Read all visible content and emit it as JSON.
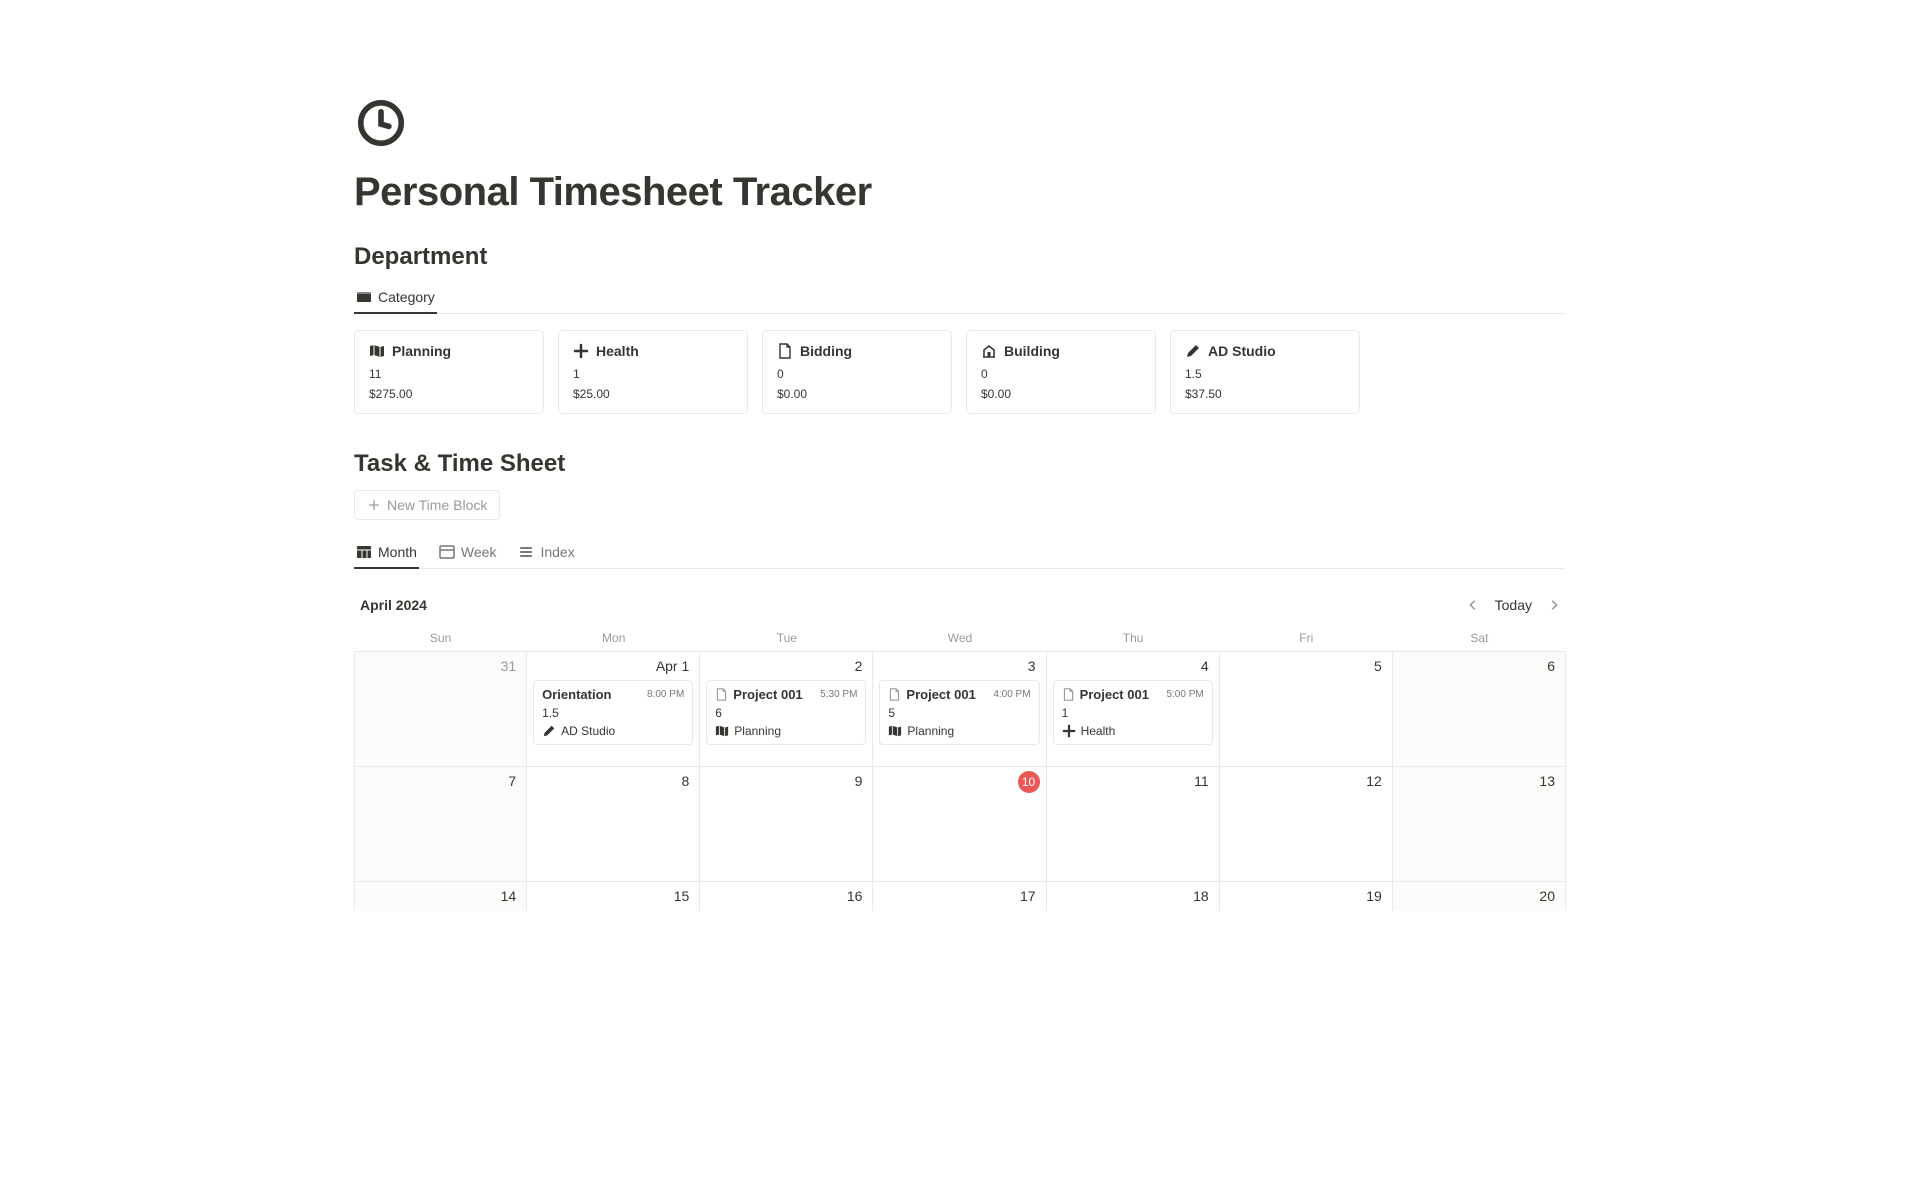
{
  "page": {
    "title": "Personal Timesheet Tracker"
  },
  "department": {
    "heading": "Department",
    "tab_label": "Category",
    "cards": [
      {
        "icon": "map-icon",
        "name": "Planning",
        "hours": "11",
        "amount": "$275.00"
      },
      {
        "icon": "plus-icon",
        "name": "Health",
        "hours": "1",
        "amount": "$25.00"
      },
      {
        "icon": "page-icon",
        "name": "Bidding",
        "hours": "0",
        "amount": "$0.00"
      },
      {
        "icon": "building-icon",
        "name": "Building",
        "hours": "0",
        "amount": "$0.00"
      },
      {
        "icon": "pencil-icon",
        "name": "AD Studio",
        "hours": "1.5",
        "amount": "$37.50"
      }
    ]
  },
  "tasksheet": {
    "heading": "Task & Time Sheet",
    "new_button": "New Time Block",
    "views": [
      {
        "icon": "cal-grid-icon",
        "label": "Month",
        "active": true
      },
      {
        "icon": "cal-week-icon",
        "label": "Week",
        "active": false
      },
      {
        "icon": "list-icon",
        "label": "Index",
        "active": false
      }
    ]
  },
  "calendar": {
    "month_label": "April 2024",
    "today_label": "Today",
    "day_headers": [
      "Sun",
      "Mon",
      "Tue",
      "Wed",
      "Thu",
      "Fri",
      "Sat"
    ],
    "rows": [
      [
        {
          "num": "31",
          "outside": true
        },
        {
          "num": "Apr 1",
          "event": {
            "title": "Orientation",
            "time": "8:00 PM",
            "hours": "1.5",
            "cat_icon": "pencil-icon",
            "cat": "AD Studio",
            "show_doc_icon": false
          }
        },
        {
          "num": "2",
          "event": {
            "title": "Project 001",
            "time": "5:30 PM",
            "hours": "6",
            "cat_icon": "map-icon",
            "cat": "Planning",
            "show_doc_icon": true
          }
        },
        {
          "num": "3",
          "event": {
            "title": "Project 001",
            "time": "4:00 PM",
            "hours": "5",
            "cat_icon": "map-icon",
            "cat": "Planning",
            "show_doc_icon": true
          }
        },
        {
          "num": "4",
          "event": {
            "title": "Project 001",
            "time": "5:00 PM",
            "hours": "1",
            "cat_icon": "plus-icon",
            "cat": "Health",
            "show_doc_icon": true
          }
        },
        {
          "num": "5"
        },
        {
          "num": "6"
        }
      ],
      [
        {
          "num": "7"
        },
        {
          "num": "8"
        },
        {
          "num": "9"
        },
        {
          "num": "10",
          "today": true
        },
        {
          "num": "11"
        },
        {
          "num": "12"
        },
        {
          "num": "13"
        }
      ],
      [
        {
          "num": "14"
        },
        {
          "num": "15"
        },
        {
          "num": "16"
        },
        {
          "num": "17"
        },
        {
          "num": "18"
        },
        {
          "num": "19"
        },
        {
          "num": "20"
        }
      ]
    ]
  }
}
